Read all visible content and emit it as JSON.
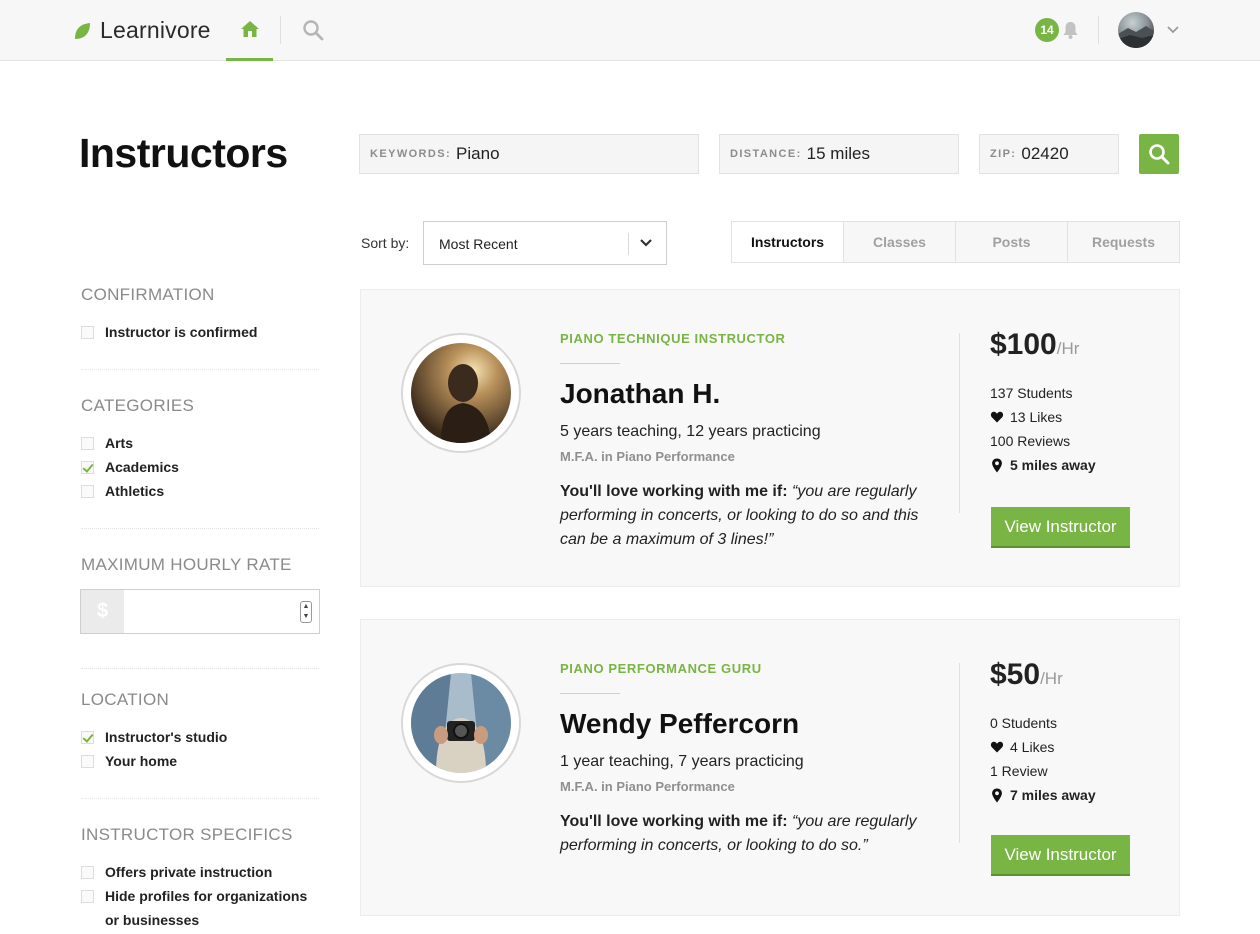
{
  "header": {
    "brand": "Learnivore",
    "notification_count": "14",
    "brand_color": "#79b544"
  },
  "page": {
    "title": "Instructors"
  },
  "search": {
    "keywords_label": "KEYWORDS:",
    "keywords_value": "Piano",
    "distance_label": "DISTANCE:",
    "distance_value": "15 miles",
    "zip_label": "ZIP:",
    "zip_value": "02420"
  },
  "sort": {
    "label": "Sort by:",
    "value": "Most Recent"
  },
  "tabs": [
    {
      "label": "Instructors",
      "active": true
    },
    {
      "label": "Classes",
      "active": false
    },
    {
      "label": "Posts",
      "active": false
    },
    {
      "label": "Requests",
      "active": false
    }
  ],
  "sidebar": {
    "confirmation": {
      "heading": "CONFIRMATION",
      "options": [
        {
          "label": "Instructor is confirmed",
          "checked": false
        }
      ]
    },
    "categories": {
      "heading": "CATEGORIES",
      "options": [
        {
          "label": "Arts",
          "checked": false
        },
        {
          "label": "Academics",
          "checked": true
        },
        {
          "label": "Athletics",
          "checked": false
        }
      ]
    },
    "rate": {
      "heading": "MAXIMUM HOURLY RATE",
      "prefix": "$",
      "value": ""
    },
    "location": {
      "heading": "LOCATION",
      "options": [
        {
          "label": "Instructor's studio",
          "checked": true
        },
        {
          "label": "Your home",
          "checked": false
        }
      ]
    },
    "specifics": {
      "heading": "INSTRUCTOR SPECIFICS",
      "options": [
        {
          "label": "Offers private instruction",
          "checked": false
        },
        {
          "label": "Hide profiles for organizations",
          "label_cont": "or businesses",
          "checked": false
        }
      ]
    }
  },
  "instructors": [
    {
      "subtitle": "PIANO TECHNIQUE INSTRUCTOR",
      "name": "Jonathan H.",
      "experience": "5 years teaching, 12 years practicing",
      "degree": "M.F.A. in Piano Performance",
      "love_lead": "You'll love working with me if:",
      "love_line1": "“you are regularly",
      "love_line2": "performing in concerts, or looking to do so and this",
      "love_line3": "can be a maximum of 3 lines!”",
      "price": "$100",
      "price_unit": "/Hr",
      "students": "137 Students",
      "likes": "13 Likes",
      "reviews": "100 Reviews",
      "distance": "5 miles away",
      "button": "View Instructor",
      "avatar_icon": "person-silhouette-photo"
    },
    {
      "subtitle": "PIANO PERFORMANCE GURU",
      "name": "Wendy Peffercorn",
      "experience": "1 year teaching, 7 years practicing",
      "degree": "M.F.A. in Piano Performance",
      "love_lead": "You'll love working with me if:",
      "love_line1": "“you are regularly",
      "love_line2": "performing in concerts, or looking to do so.”",
      "price": "$50",
      "price_unit": "/Hr",
      "students": "0 Students",
      "likes": "4 Likes",
      "reviews": "1 Review",
      "distance": "7 miles away",
      "button": "View Instructor",
      "avatar_icon": "camera-holder-photo"
    }
  ]
}
